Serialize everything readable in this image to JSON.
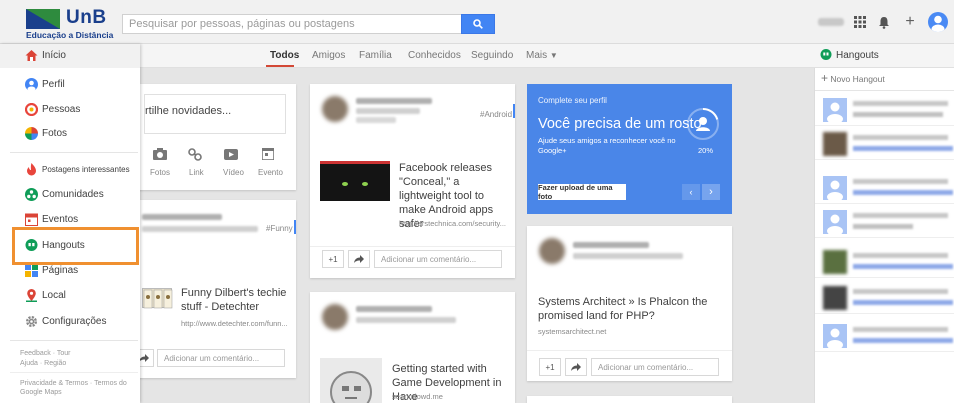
{
  "brand": {
    "name": "UnB",
    "subtitle": "Educação a Distância",
    "blue": "#1a3f8c",
    "green": "#2e8b3e"
  },
  "search": {
    "placeholder": "Pesquisar por pessoas, páginas ou postagens"
  },
  "tabs": [
    {
      "label": "Todos",
      "active": true
    },
    {
      "label": "Amigos"
    },
    {
      "label": "Família"
    },
    {
      "label": "Conhecidos"
    },
    {
      "label": "Seguindo"
    },
    {
      "label": "Mais"
    }
  ],
  "menu": {
    "home": "Início",
    "items": [
      {
        "label": "Perfil",
        "icon": "profile-icon"
      },
      {
        "label": "Pessoas",
        "icon": "people-icon"
      },
      {
        "label": "Fotos",
        "icon": "photos-icon"
      },
      {
        "label": "Postagens interessantes",
        "icon": "explore-icon"
      },
      {
        "label": "Comunidades",
        "icon": "communities-icon"
      },
      {
        "label": "Eventos",
        "icon": "events-icon"
      },
      {
        "label": "Hangouts",
        "icon": "hangouts-icon"
      },
      {
        "label": "Páginas",
        "icon": "pages-icon"
      },
      {
        "label": "Local",
        "icon": "local-icon"
      },
      {
        "label": "Configurações",
        "icon": "settings-icon"
      }
    ],
    "footer": {
      "feedback": "Feedback",
      "tour": "Tour",
      "help": "Ajuda",
      "region": "Região",
      "privacy": "Privacidade & Termos",
      "maps_terms": "Termos do",
      "maps": "Google Maps"
    }
  },
  "share": {
    "prompt": "rtilhe novidades...",
    "actions": [
      "Fotos",
      "Link",
      "Vídeo",
      "Evento"
    ]
  },
  "posts": {
    "facebook": {
      "tag": "#Android",
      "title": "Facebook releases \"Conceal,\" a lightweight tool to make Android apps safer",
      "url": "http://arstechnica.com/security..."
    },
    "dilbert": {
      "tag": "#Funny",
      "title": "Funny Dilbert's techie stuff - Detechter",
      "url": "http://www.detechter.com/funn..."
    },
    "phalcon": {
      "title": "Systems Architect » Is Phalcon the promised land for PHP?",
      "url": "systemsarchitect.net"
    },
    "haxe": {
      "title": "Getting started with Game Development in Haxe",
      "url": "seanodowd.me"
    },
    "plus_one": "+1",
    "comment_placeholder": "Adicionar um comentário..."
  },
  "profile_card": {
    "heading": "Complete seu perfil",
    "title": "Você precisa de um rosto",
    "text": "Ajude seus amigos a reconhecer você no Google+",
    "progress": "20%",
    "button": "Fazer upload de uma foto",
    "color": "#4a86e8"
  },
  "hangouts": {
    "title": "Hangouts",
    "new": "Novo Hangout"
  }
}
